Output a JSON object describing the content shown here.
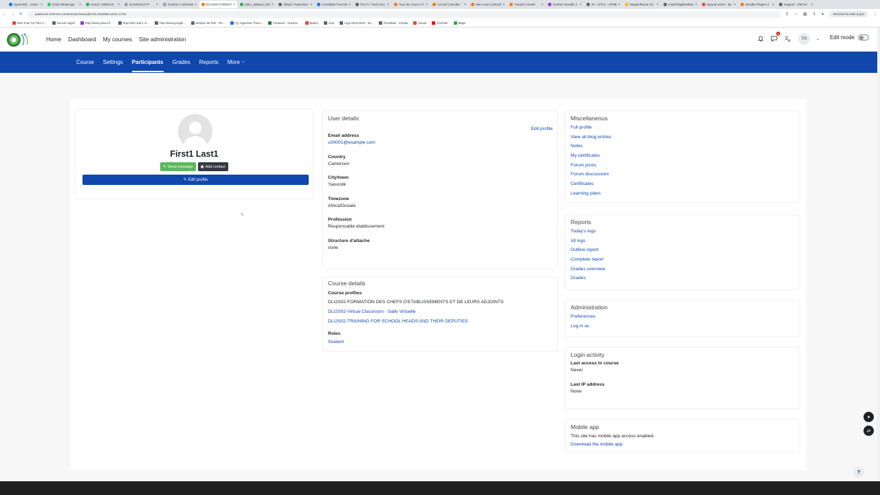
{
  "browser": {
    "tabs": [
      {
        "label": "Speechify - Listen",
        "color": "#1a73e8"
      },
      {
        "label": "(125) WhatsApp",
        "color": "#25d366"
      },
      {
        "label": "Home | INDEXIS",
        "color": "#34a853"
      },
      {
        "label": "DLI2S02S4 FF",
        "color": "#9aa0a6"
      },
      {
        "label": "Gestion | Administr",
        "color": "#9aa0a6"
      },
      {
        "label": "DLI2S02 FORMAT",
        "color": "#f57c00",
        "active": true
      },
      {
        "label": "pdnc_dataset_2023",
        "color": "#34a853"
      },
      {
        "label": "Ollepic Traduction",
        "color": "#5f6368"
      },
      {
        "label": "Candidats Fonctions",
        "color": "#1a73e8"
      },
      {
        "label": "Fire Fr / Itech.xlsx",
        "color": "#5f6368"
      },
      {
        "label": "Tous les cours | Fre",
        "color": "#f57c00"
      },
      {
        "label": "Accueil | Moodle",
        "color": "#f57c00"
      },
      {
        "label": "Mes cours | Moodle",
        "color": "#f57c00"
      },
      {
        "label": "Tutorat Conseil",
        "color": "#f57c00"
      },
      {
        "label": "Gestion Moodle 2",
        "color": "#9334e6"
      },
      {
        "label": "19 - CFCS - APME",
        "color": "#5f6368"
      },
      {
        "label": "Megalotheme Gu",
        "color": "#fbbc04"
      },
      {
        "label": "Install BigBlueButt",
        "color": "#5f6368"
      },
      {
        "label": "Spread users - Bo",
        "color": "#ea4335"
      },
      {
        "label": "Moodle Plugins d",
        "color": "#f57c00"
      },
      {
        "label": "Support - Elemnt",
        "color": "#5f6368"
      }
    ],
    "url": "padecons.mmmoo.com/en/user/view.php?id=16328&course=1746",
    "profile_pill": "Terminer la mise à jour",
    "bookmarks": [
      {
        "label": "Mon Pour Ça Titre C...",
        "color": "#ea4335"
      },
      {
        "label": "Nouvel onglet",
        "color": "#5f6368"
      },
      {
        "label": "http://www.yahoo.fr...",
        "color": "#9334e6"
      },
      {
        "label": "http://192.168.1.1/...",
        "color": "#5f6368"
      },
      {
        "label": "http://www.google...",
        "color": "#5f6368"
      },
      {
        "label": "analyse de Rim - Re...",
        "color": "#5f6368"
      },
      {
        "label": "(1) Hypomax Tresu...",
        "color": "#1877f2"
      },
      {
        "label": "Features - Gravit3...",
        "color": "#188038"
      },
      {
        "label": "Badoo",
        "color": "#ea4335"
      },
      {
        "label": "Gup",
        "color": "#5f6368"
      },
      {
        "label": "Liga 2015-2016 - Ita...",
        "color": "#5f6368"
      },
      {
        "label": "Resultats - Cheats",
        "color": "#5f6368"
      },
      {
        "label": "Gmail",
        "color": "#ea4335"
      },
      {
        "label": "YouTube",
        "color": "#ff0000"
      },
      {
        "label": "Maps",
        "color": "#34a853"
      }
    ]
  },
  "header": {
    "nav": [
      "Home",
      "Dashboard",
      "My courses",
      "Site administration"
    ],
    "notif_count": "5",
    "user_initials": "TR",
    "edit_mode_label": "Edit mode"
  },
  "secondary_nav": {
    "items": [
      "Course",
      "Settings",
      "Participants",
      "Grades",
      "Reports"
    ],
    "more_label": "More",
    "active": "Participants"
  },
  "profile": {
    "fullname": "First1 Last1",
    "send_message": "Send message",
    "add_contact": "Add contact",
    "edit_profile": "Edit profile"
  },
  "user_details": {
    "title": "User details",
    "edit_profile_link": "Edit profile",
    "fields": [
      {
        "label": "Email address",
        "value": "u00001@example.com",
        "link": true
      },
      {
        "label": "Country",
        "value": "Cameroon"
      },
      {
        "label": "City/town",
        "value": "Yaoundé"
      },
      {
        "label": "Timezone",
        "value": "Africa/Douala"
      },
      {
        "label": "Profession",
        "value": "Responsable établissement"
      },
      {
        "label": "Structure d'attache",
        "value": "none"
      }
    ]
  },
  "course_details": {
    "title": "Course details",
    "profiles_label": "Course profiles",
    "courses": [
      {
        "name": "DLI2S02-FORMATION DES CHEFS D'ETABLISSEMENTS ET DE LEURS ADJOINTS",
        "link": false
      },
      {
        "name": "DLI2S02-Virtual Classroom - Salle Virtuelle",
        "link": true
      },
      {
        "name": "DLI2S02-TRAINING FOR SCHOOL HEADS AND THEIR DEPUTIES",
        "link": true
      }
    ],
    "roles_label": "Roles",
    "role": "Student"
  },
  "miscellaneous": {
    "title": "Miscellaneous",
    "links": [
      "Full profile",
      "View all blog entries",
      "Notes",
      "My certificates",
      "Forum posts",
      "Forum discussions",
      "Certificates",
      "Learning plans"
    ]
  },
  "reports": {
    "title": "Reports",
    "links": [
      "Today's logs",
      "All logs",
      "Outline report",
      "Complete report",
      "Grades overview",
      "Grades"
    ]
  },
  "administration": {
    "title": "Administration",
    "links": [
      "Preferences",
      "Log in as"
    ]
  },
  "login_activity": {
    "title": "Login activity",
    "fields": [
      {
        "label": "Last access to course",
        "value": "Never"
      },
      {
        "label": "Last IP address",
        "value": "None"
      }
    ]
  },
  "mobile_app": {
    "title": "Mobile app",
    "text": "This site has mobile app access enabled.",
    "link": "Download the mobile app."
  },
  "colors": {
    "brand_blue": "#0f47ad",
    "green_button": "#5cb85c",
    "dark_button": "#343a40"
  }
}
